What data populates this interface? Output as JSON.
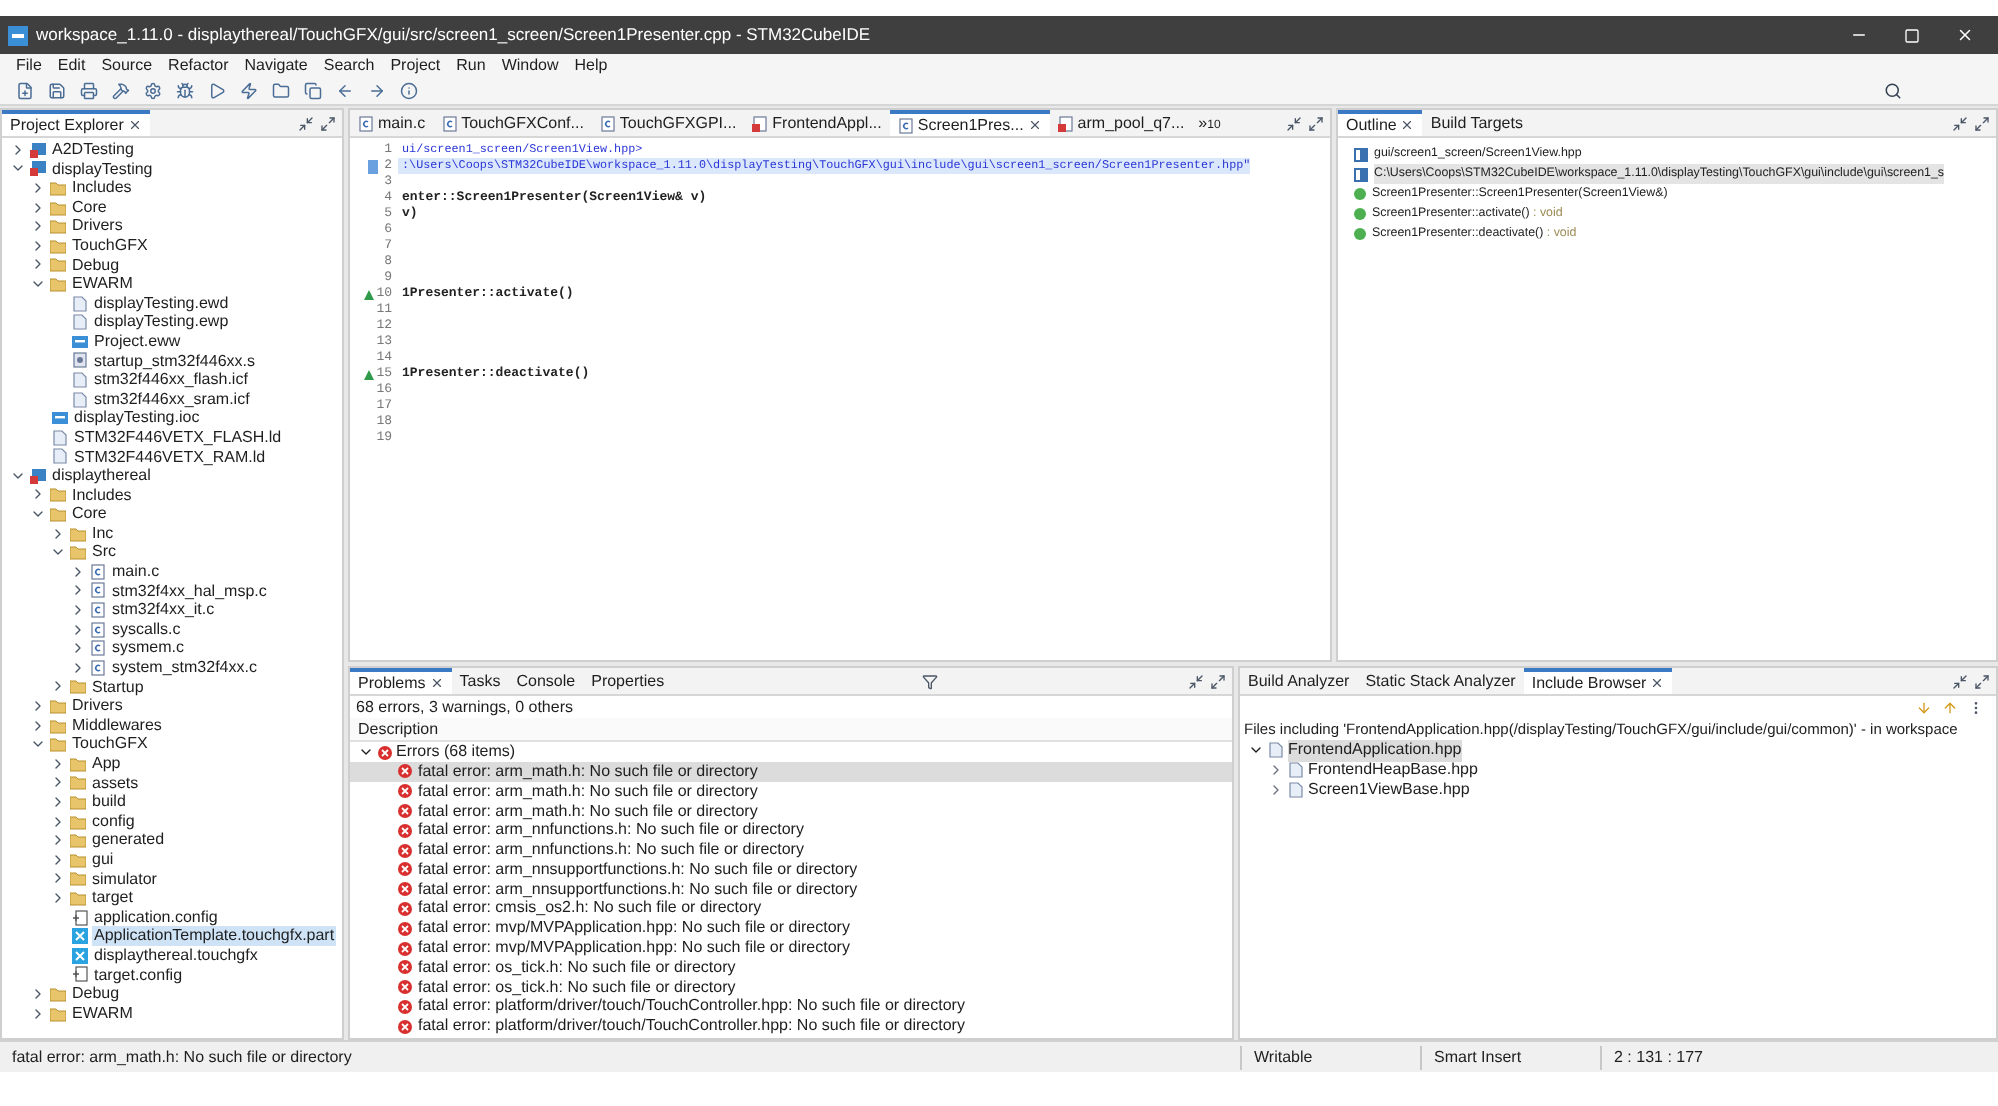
{
  "window": {
    "title": "workspace_1.11.0 - displaythereal/TouchGFX/gui/src/screen1_screen/Screen1Presenter.cpp - STM32CubeIDE"
  },
  "menu": [
    "File",
    "Edit",
    "Source",
    "Refactor",
    "Navigate",
    "Search",
    "Project",
    "Run",
    "Window",
    "Help"
  ],
  "explorer": {
    "title": "Project Explorer",
    "tree": [
      {
        "label": "A2DTesting",
        "kind": "project",
        "expanded": false,
        "selected": false
      },
      {
        "label": "displayTesting",
        "kind": "project",
        "expanded": true,
        "selected": false,
        "children": [
          {
            "label": "Includes",
            "kind": "includes",
            "expanded": false,
            "selected": false
          },
          {
            "label": "Core",
            "kind": "folder",
            "expanded": false,
            "selected": false
          },
          {
            "label": "Drivers",
            "kind": "folder",
            "expanded": false,
            "selected": false
          },
          {
            "label": "TouchGFX",
            "kind": "folder",
            "expanded": false,
            "selected": false
          },
          {
            "label": "Debug",
            "kind": "folder",
            "expanded": false,
            "selected": false
          },
          {
            "label": "EWARM",
            "kind": "folder",
            "expanded": true,
            "selected": false,
            "children": [
              {
                "label": "displayTesting.ewd",
                "kind": "file",
                "selected": false
              },
              {
                "label": "displayTesting.ewp",
                "kind": "file",
                "selected": false
              },
              {
                "label": "Project.eww",
                "kind": "ide",
                "selected": false
              },
              {
                "label": "startup_stm32f446xx.s",
                "kind": "asm",
                "selected": false
              },
              {
                "label": "stm32f446xx_flash.icf",
                "kind": "file",
                "selected": false
              },
              {
                "label": "stm32f446xx_sram.icf",
                "kind": "file",
                "selected": false
              }
            ]
          },
          {
            "label": "displayTesting.ioc",
            "kind": "ide",
            "selected": false
          },
          {
            "label": "STM32F446VETX_FLASH.ld",
            "kind": "file",
            "selected": false
          },
          {
            "label": "STM32F446VETX_RAM.ld",
            "kind": "file",
            "selected": false
          }
        ]
      },
      {
        "label": "displaythereal",
        "kind": "project",
        "expanded": true,
        "selected": false,
        "children": [
          {
            "label": "Includes",
            "kind": "includes",
            "expanded": false,
            "selected": false
          },
          {
            "label": "Core",
            "kind": "folder",
            "expanded": true,
            "selected": false,
            "children": [
              {
                "label": "Inc",
                "kind": "folder",
                "expanded": false,
                "selected": false
              },
              {
                "label": "Src",
                "kind": "folder",
                "expanded": true,
                "selected": false,
                "children": [
                  {
                    "label": "main.c",
                    "kind": "source",
                    "expanded": false,
                    "selected": false
                  },
                  {
                    "label": "stm32f4xx_hal_msp.c",
                    "kind": "source",
                    "expanded": false,
                    "selected": false
                  },
                  {
                    "label": "stm32f4xx_it.c",
                    "kind": "source",
                    "expanded": false,
                    "selected": false
                  },
                  {
                    "label": "syscalls.c",
                    "kind": "source",
                    "expanded": false,
                    "selected": false
                  },
                  {
                    "label": "sysmem.c",
                    "kind": "source",
                    "expanded": false,
                    "selected": false
                  },
                  {
                    "label": "system_stm32f4xx.c",
                    "kind": "source",
                    "expanded": false,
                    "selected": false
                  }
                ]
              },
              {
                "label": "Startup",
                "kind": "folder",
                "expanded": false,
                "selected": false
              }
            ]
          },
          {
            "label": "Drivers",
            "kind": "folder",
            "expanded": false,
            "selected": false
          },
          {
            "label": "Middlewares",
            "kind": "folder",
            "expanded": false,
            "selected": false
          },
          {
            "label": "TouchGFX",
            "kind": "folder",
            "expanded": true,
            "selected": false,
            "children": [
              {
                "label": "App",
                "kind": "folder",
                "expanded": false,
                "selected": false
              },
              {
                "label": "assets",
                "kind": "folder",
                "expanded": false,
                "selected": false
              },
              {
                "label": "build",
                "kind": "folder",
                "expanded": false,
                "selected": false
              },
              {
                "label": "config",
                "kind": "folder",
                "expanded": false,
                "selected": false
              },
              {
                "label": "generated",
                "kind": "folder",
                "expanded": false,
                "selected": false
              },
              {
                "label": "gui",
                "kind": "folder",
                "expanded": false,
                "selected": false
              },
              {
                "label": "simulator",
                "kind": "folder",
                "expanded": false,
                "selected": false
              },
              {
                "label": "target",
                "kind": "folder",
                "expanded": false,
                "selected": false
              },
              {
                "label": "application.config",
                "kind": "config",
                "selected": false
              },
              {
                "label": "ApplicationTemplate.touchgfx.part",
                "kind": "touchgfx",
                "selected": true
              },
              {
                "label": "displaythereal.touchgfx",
                "kind": "touchgfx",
                "selected": false
              },
              {
                "label": "target.config",
                "kind": "config",
                "selected": false
              }
            ]
          },
          {
            "label": "Debug",
            "kind": "folder",
            "expanded": false,
            "selected": false
          },
          {
            "label": "EWARM",
            "kind": "folder",
            "expanded": false,
            "selected": false
          }
        ]
      }
    ]
  },
  "editor": {
    "tabs": [
      {
        "label": "main.c",
        "kind": "source",
        "selected": false
      },
      {
        "label": "TouchGFXConf...",
        "kind": "source",
        "selected": false
      },
      {
        "label": "TouchGFXGPI...",
        "kind": "source",
        "selected": false
      },
      {
        "label": "FrontendAppl...",
        "kind": "header",
        "selected": false
      },
      {
        "label": "Screen1Pres...",
        "kind": "source",
        "selected": true
      },
      {
        "label": "arm_pool_q7...",
        "kind": "header",
        "selected": false
      }
    ],
    "overflow": "»",
    "overflow_count": "10",
    "lines": [
      {
        "number": "1",
        "text": "ui/screen1_screen/Screen1View.hpp>",
        "kind": "include",
        "override": false,
        "selected": false
      },
      {
        "number": "2",
        "text": ":\\Users\\Coops\\STM32CubeIDE\\workspace_1.11.0\\displayTesting\\TouchGFX\\gui\\include\\gui\\screen1_screen/Screen1Presenter.hpp\"",
        "kind": "include",
        "override": false,
        "selected": true
      },
      {
        "number": "3",
        "override": false,
        "selected": false
      },
      {
        "number": "4",
        "text": "enter::Screen1Presenter(Screen1View& v)",
        "kind": "code",
        "override": false,
        "selected": false
      },
      {
        "number": "5",
        "text": "v)",
        "kind": "code",
        "override": false,
        "selected": false
      },
      {
        "number": "6",
        "override": false,
        "selected": false
      },
      {
        "number": "7",
        "override": false,
        "selected": false
      },
      {
        "number": "8",
        "override": false,
        "selected": false
      },
      {
        "number": "9",
        "override": false,
        "selected": false
      },
      {
        "number": "10",
        "text": "1Presenter::activate()",
        "kind": "code",
        "override": true,
        "selected": false
      },
      {
        "number": "11",
        "override": false,
        "selected": false
      },
      {
        "number": "12",
        "override": false,
        "selected": false
      },
      {
        "number": "13",
        "override": false,
        "selected": false
      },
      {
        "number": "14",
        "override": false,
        "selected": false
      },
      {
        "number": "15",
        "text": "1Presenter::deactivate()",
        "kind": "code",
        "override": true,
        "selected": false
      },
      {
        "number": "16",
        "override": false,
        "selected": false
      },
      {
        "number": "17",
        "override": false,
        "selected": false
      },
      {
        "number": "18",
        "override": false,
        "selected": false
      },
      {
        "number": "19",
        "override": false,
        "selected": false
      }
    ]
  },
  "outline": {
    "tabs": [
      {
        "label": "Outline",
        "selected": true
      },
      {
        "label": "Build Targets",
        "selected": false
      }
    ],
    "items": [
      {
        "text": "gui/screen1_screen/Screen1View.hpp",
        "kind": "include",
        "selected": false
      },
      {
        "text": "C:\\Users\\Coops\\STM32CubeIDE\\workspace_1.11.0\\displayTesting\\TouchGFX\\gui\\include\\gui\\screen1_s",
        "kind": "include",
        "selected": true
      },
      {
        "text": "Screen1Presenter::Screen1Presenter(Screen1View&)",
        "kind": "method",
        "selected": false
      },
      {
        "text": "Screen1Presenter::activate()",
        "detail": ": void",
        "kind": "method",
        "selected": false
      },
      {
        "text": "Screen1Presenter::deactivate()",
        "detail": ": void",
        "kind": "method",
        "selected": false
      }
    ]
  },
  "problems": {
    "tabs": [
      {
        "label": "Problems",
        "selected": true
      },
      {
        "label": "Tasks",
        "selected": false
      },
      {
        "label": "Console",
        "selected": false
      },
      {
        "label": "Properties",
        "selected": false
      }
    ],
    "summary": "68 errors, 3 warnings, 0 others",
    "column": "Description",
    "group": {
      "label": "Errors (68 items)",
      "expanded": true
    },
    "items": [
      {
        "text": "fatal error: arm_math.h: No such file or directory",
        "selected": true
      },
      {
        "text": "fatal error: arm_math.h: No such file or directory",
        "selected": false
      },
      {
        "text": "fatal error: arm_math.h: No such file or directory",
        "selected": false
      },
      {
        "text": "fatal error: arm_nnfunctions.h: No such file or directory",
        "selected": false
      },
      {
        "text": "fatal error: arm_nnfunctions.h: No such file or directory",
        "selected": false
      },
      {
        "text": "fatal error: arm_nnsupportfunctions.h: No such file or directory",
        "selected": false
      },
      {
        "text": "fatal error: arm_nnsupportfunctions.h: No such file or directory",
        "selected": false
      },
      {
        "text": "fatal error: cmsis_os2.h: No such file or directory",
        "selected": false
      },
      {
        "text": "fatal error: mvp/MVPApplication.hpp: No such file or directory",
        "selected": false
      },
      {
        "text": "fatal error: mvp/MVPApplication.hpp: No such file or directory",
        "selected": false
      },
      {
        "text": "fatal error: os_tick.h: No such file or directory",
        "selected": false
      },
      {
        "text": "fatal error: os_tick.h: No such file or directory",
        "selected": false
      },
      {
        "text": "fatal error: platform/driver/touch/TouchController.hpp: No such file or directory",
        "selected": false
      },
      {
        "text": "fatal error: platform/driver/touch/TouchController.hpp: No such file or directory",
        "selected": false
      }
    ]
  },
  "include_browser": {
    "tabs": [
      {
        "label": "Build Analyzer",
        "selected": false
      },
      {
        "label": "Static Stack Analyzer",
        "selected": false
      },
      {
        "label": "Include Browser",
        "selected": true
      }
    ],
    "caption": "Files including 'FrontendApplication.hpp(/displayTesting/TouchGFX/gui/include/gui/common)' - in workspace",
    "root": {
      "label": "FrontendApplication.hpp",
      "expanded": true,
      "selected": true
    },
    "children": [
      {
        "label": "FrontendHeapBase.hpp",
        "expanded": false,
        "selected": false
      },
      {
        "label": "Screen1ViewBase.hpp",
        "expanded": false,
        "selected": false
      }
    ]
  },
  "status_bar": {
    "message": "fatal error: arm_math.h: No such file or directory",
    "fields": [
      "Writable",
      "Smart Insert",
      "2 : 131 : 177"
    ]
  }
}
